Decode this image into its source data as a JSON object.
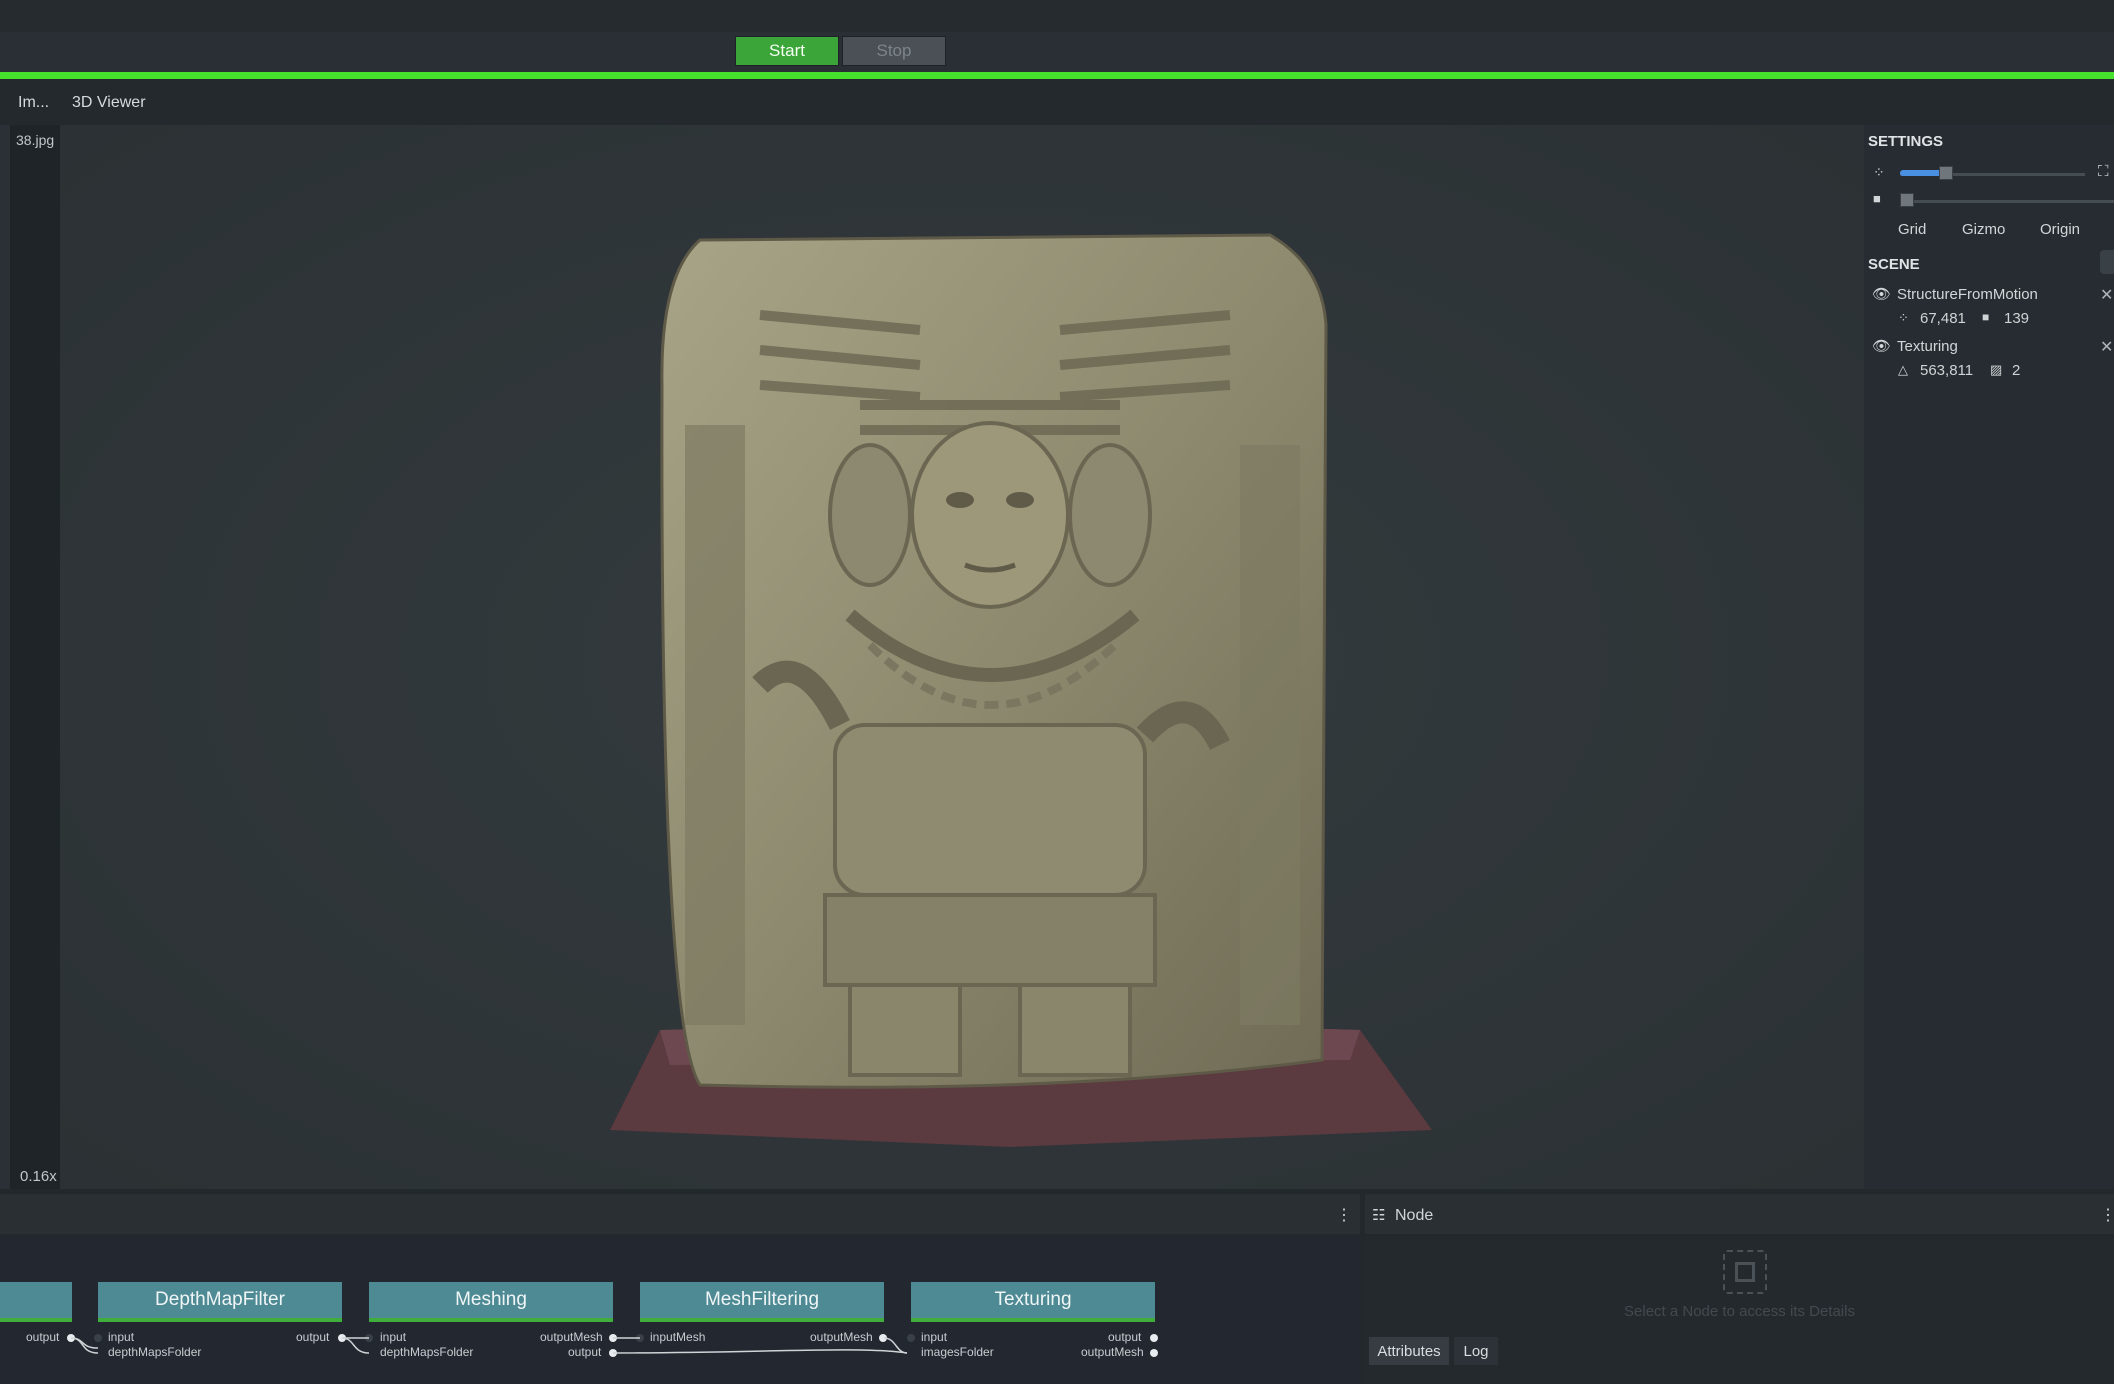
{
  "toolbar": {
    "start_label": "Start",
    "stop_label": "Stop",
    "progress": 1.0
  },
  "tabs": [
    {
      "label": "Im..."
    },
    {
      "label": "3D Viewer"
    }
  ],
  "image_strip": {
    "current_file": "38.jpg",
    "zoom": "0.16x"
  },
  "settings": {
    "title": "SETTINGS",
    "point_size_level": 0.25,
    "camera_scale_level": 0.0,
    "toggles": [
      "Grid",
      "Gizmo",
      "Origin"
    ]
  },
  "scene": {
    "title": "SCENE",
    "items": [
      {
        "name": "StructureFromMotion",
        "stat1": "67,481",
        "stat2": "139"
      },
      {
        "name": "Texturing",
        "stat1": "563,811",
        "stat2": "2"
      }
    ]
  },
  "graph": {
    "nodes": [
      {
        "label": "DepthMapFilter",
        "inputs": [
          "input",
          "depthMapsFolder"
        ],
        "outputs": [
          "output"
        ]
      },
      {
        "label": "Meshing",
        "inputs": [
          "input",
          "depthMapsFolder"
        ],
        "outputs": [
          "outputMesh",
          "output"
        ]
      },
      {
        "label": "MeshFiltering",
        "inputs": [
          "inputMesh"
        ],
        "outputs": [
          "outputMesh"
        ]
      },
      {
        "label": "Texturing",
        "inputs": [
          "input",
          "imagesFolder"
        ],
        "outputs": [
          "output",
          "outputMesh"
        ]
      }
    ],
    "prev_output": "output"
  },
  "node_panel": {
    "title": "Node",
    "hint": "Select a Node to access its Details",
    "tabs": [
      "Attributes",
      "Log"
    ]
  },
  "colors": {
    "accent_green": "#46e02c",
    "node_teal": "#4d8a94",
    "slider_blue": "#4a90e2"
  }
}
